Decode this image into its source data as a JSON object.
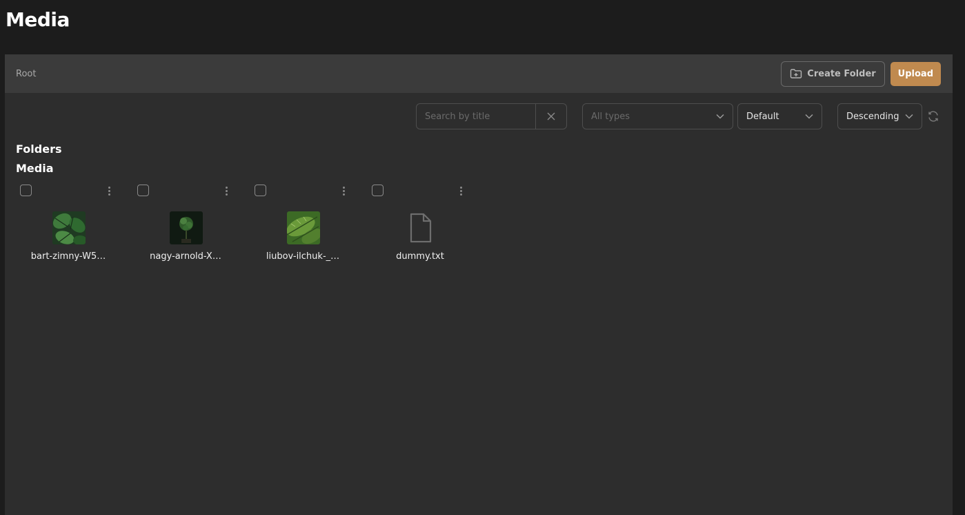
{
  "page": {
    "title": "Media"
  },
  "header": {
    "breadcrumb": "Root",
    "create_folder_label": "Create Folder",
    "upload_label": "Upload"
  },
  "toolbar": {
    "search_placeholder": "Search by title",
    "types_placeholder": "All types",
    "sort_value": "Default",
    "order_value": "Descending"
  },
  "sections": {
    "folders_title": "Folders",
    "media_title": "Media"
  },
  "media": [
    {
      "name": "bart-zimny-W5…",
      "kind": "image"
    },
    {
      "name": "nagy-arnold-X…",
      "kind": "image"
    },
    {
      "name": "liubov-ilchuk-_…",
      "kind": "image"
    },
    {
      "name": "dummy.txt",
      "kind": "file"
    }
  ],
  "colors": {
    "accent": "#c08a4f",
    "background": "#1c1c1c",
    "panel": "#2d2d2d",
    "panel_header": "#3b3b3b"
  }
}
